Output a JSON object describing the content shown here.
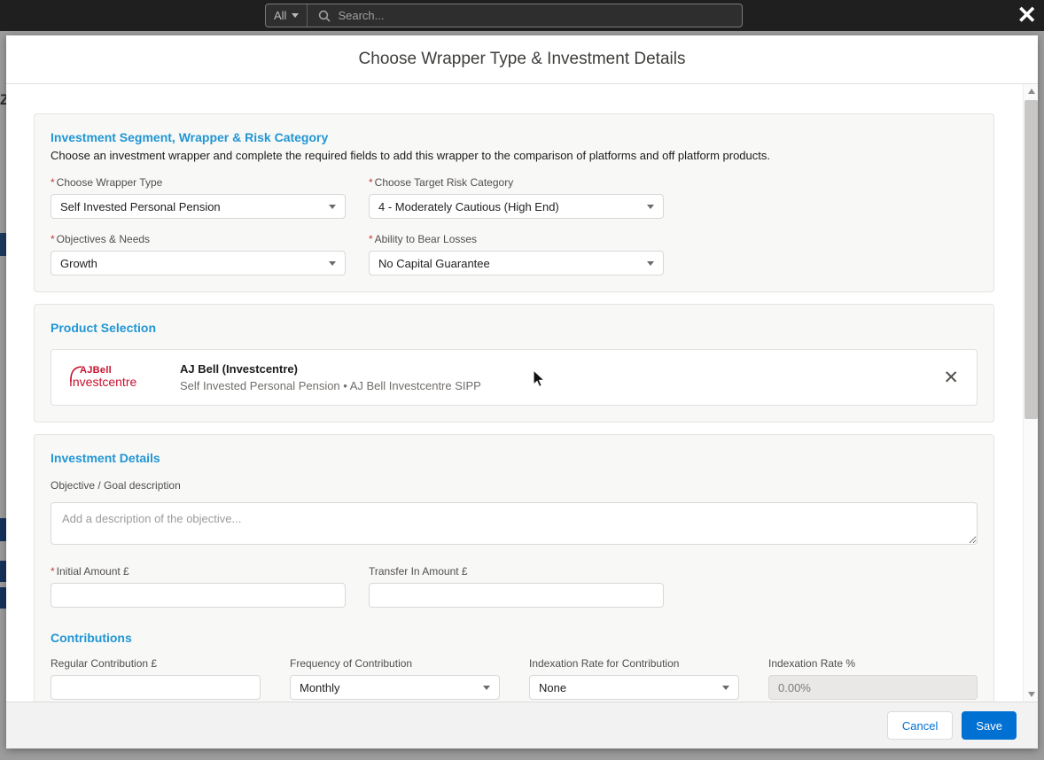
{
  "topbar": {
    "scope": "All",
    "placeholder": "Search...",
    "close": "✕"
  },
  "backdrop": {
    "fragment_text": "Z"
  },
  "modal": {
    "title": "Choose Wrapper Type & Investment Details"
  },
  "required_marker": "*",
  "segment": {
    "heading": "Investment Segment, Wrapper & Risk Category",
    "description": "Choose an investment wrapper and complete the required fields to add this wrapper to the comparison of platforms and off platform products.",
    "wrapper_type_label": "Choose Wrapper Type",
    "wrapper_type_value": "Self Invested Personal Pension",
    "risk_label": "Choose Target Risk Category",
    "risk_value": "4 - Moderately Cautious (High End)",
    "objectives_label": "Objectives & Needs",
    "objectives_value": "Growth",
    "losses_label": "Ability to Bear Losses",
    "losses_value": "No Capital Guarantee"
  },
  "product": {
    "heading": "Product Selection",
    "logo_top": "AJBell",
    "logo_bottom": "Investcentre",
    "name": "AJ Bell (Investcentre)",
    "subtitle": "Self Invested Personal Pension • AJ Bell Investcentre SIPP",
    "remove": "✕"
  },
  "details": {
    "heading": "Investment Details",
    "objective_label": "Objective / Goal description",
    "objective_placeholder": "Add a description of the objective...",
    "initial_label": "Initial Amount £",
    "transfer_label": "Transfer In Amount £"
  },
  "contributions": {
    "heading": "Contributions",
    "regular_label": "Regular Contribution £",
    "frequency_label": "Frequency of Contribution",
    "frequency_value": "Monthly",
    "indexation_label": "Indexation Rate for Contribution",
    "indexation_value": "None",
    "rate_label": "Indexation Rate %",
    "rate_value": "0.00%"
  },
  "footer": {
    "cancel": "Cancel",
    "save": "Save"
  },
  "colors": {
    "heading_accent": "#2196d3",
    "save_button": "#0070d2",
    "required": "#c23934"
  }
}
